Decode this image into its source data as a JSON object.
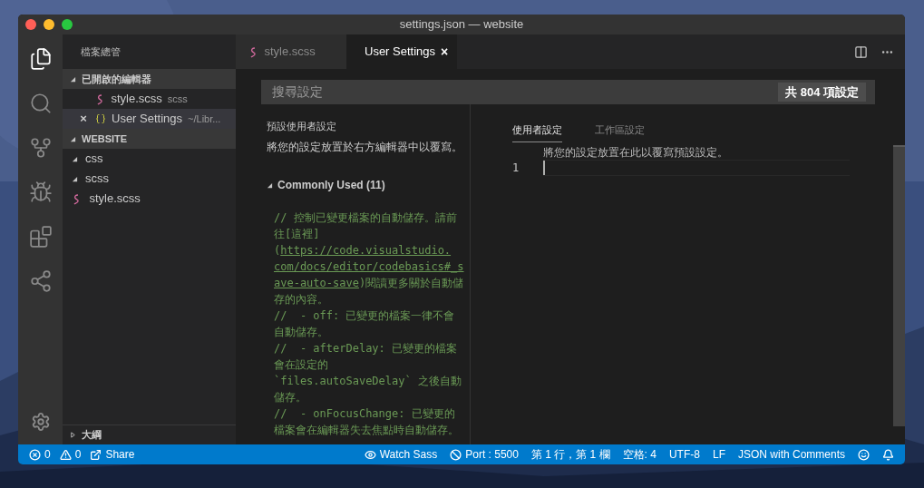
{
  "window": {
    "title": "settings.json — website"
  },
  "activity_bar": [
    {
      "kind": "files",
      "selected": true
    },
    {
      "kind": "search",
      "selected": false
    },
    {
      "kind": "source-control",
      "selected": false
    },
    {
      "kind": "debug",
      "selected": false
    },
    {
      "kind": "extensions",
      "selected": false
    },
    {
      "kind": "remote",
      "selected": false
    }
  ],
  "sidebar": {
    "title": "檔案總管",
    "open_editors": {
      "label": "已開啟的編輯器",
      "expanded": true,
      "items": [
        {
          "kind": "scss",
          "name": "style.scss",
          "description": "scss",
          "selected": false
        },
        {
          "kind": "json",
          "name": "User Settings",
          "description": "~/Libr...",
          "selected": true,
          "close": "×"
        }
      ]
    },
    "folder": {
      "label": "WEBSITE",
      "expanded": true,
      "children": [
        {
          "name": "css",
          "kind": "folder",
          "expanded": true
        },
        {
          "name": "scss",
          "kind": "folder",
          "expanded": true,
          "children": [
            {
              "name": "style.scss",
              "kind": "scss"
            }
          ]
        }
      ]
    },
    "outline": {
      "label": "大綱",
      "expanded": false
    }
  },
  "tabs": [
    {
      "kind": "scss",
      "label": "style.scss",
      "selected": false
    },
    {
      "kind": "json",
      "label": "User Settings",
      "selected": true,
      "close": "×"
    }
  ],
  "search": {
    "placeholder": "搜尋設定",
    "count": "共 804 項設定"
  },
  "default_settings": {
    "title": "預設使用者設定",
    "description": "將您的設定放置於右方編輯器中以覆寫。",
    "group": {
      "label": "Commonly Used (11)",
      "expanded": true
    },
    "code_lines": [
      [
        {
          "text": "// 控制已變更檔案的自動儲存。請前",
          "link": false
        }
      ],
      [
        {
          "text": "往[這裡]",
          "link": false
        }
      ],
      [
        {
          "text": "(",
          "link": false
        },
        {
          "text": "https://code.visualstudio.",
          "link": true
        }
      ],
      [
        {
          "text": "com/docs/editor/codebasics#_s",
          "link": true
        }
      ],
      [
        {
          "text": "ave-auto-save",
          "link": true
        },
        {
          "text": ")閱讀更多關於自動儲",
          "link": false
        }
      ],
      [
        {
          "text": "存的內容。",
          "link": false
        }
      ],
      [
        {
          "text": "//  - off: 已變更的檔案一律不會",
          "link": false
        }
      ],
      [
        {
          "text": "自動儲存。",
          "link": false
        }
      ],
      [
        {
          "text": "//  - afterDelay: 已變更的檔案",
          "link": false
        }
      ],
      [
        {
          "text": "會在設定的",
          "link": false
        }
      ],
      [
        {
          "text": "`files.autoSaveDelay` 之後自動",
          "link": false
        }
      ],
      [
        {
          "text": "儲存。",
          "link": false
        }
      ],
      [
        {
          "text": "//  - onFocusChange: 已變更的",
          "link": false
        }
      ],
      [
        {
          "text": "檔案會在編輯器失去焦點時自動儲存。",
          "link": false
        }
      ]
    ]
  },
  "user_settings": {
    "tabs": [
      {
        "label": "使用者設定",
        "selected": true
      },
      {
        "label": "工作區設定",
        "selected": false
      }
    ],
    "hint": "將您的設定放置在此以覆寫預設設定。",
    "line_number": "1"
  },
  "status_bar": {
    "left": [
      {
        "kind": "errors",
        "text": "0"
      },
      {
        "kind": "warnings",
        "text": "0"
      },
      {
        "kind": "share",
        "text": "Share"
      }
    ],
    "right": [
      {
        "kind": "eye",
        "text": "Watch Sass"
      },
      {
        "kind": "port",
        "text": "Port : 5500"
      },
      {
        "kind": "text",
        "text": "第 1 行，第 1 欄"
      },
      {
        "kind": "text",
        "text": "空格: 4"
      },
      {
        "kind": "text",
        "text": "UTF-8"
      },
      {
        "kind": "text",
        "text": "LF"
      },
      {
        "kind": "text",
        "text": "JSON with Comments"
      },
      {
        "kind": "smiley"
      },
      {
        "kind": "bell"
      }
    ]
  }
}
